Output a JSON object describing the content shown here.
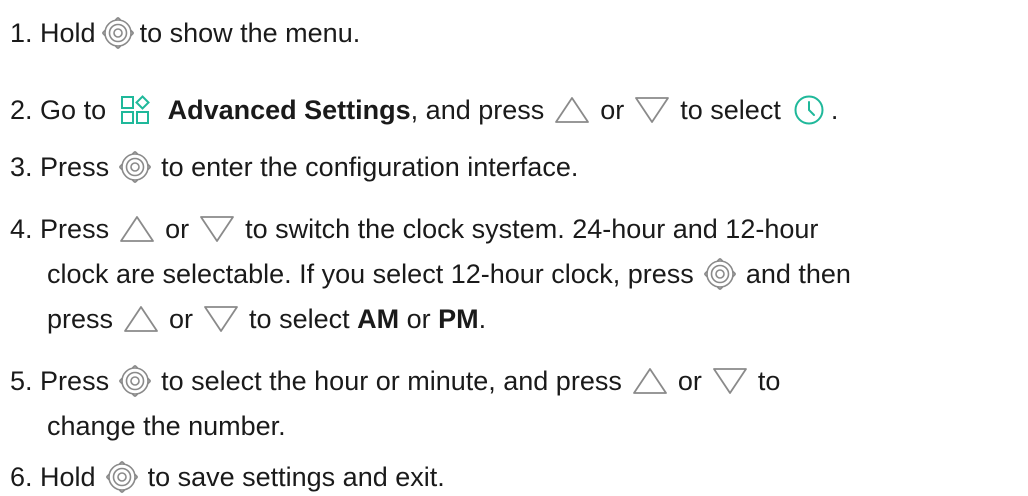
{
  "steps": [
    {
      "num": "1.",
      "text_a": "Hold",
      "text_b": "to show the menu."
    },
    {
      "num": "2.",
      "text_a": "Go to",
      "bold_a": "Advanced Settings",
      "text_b": ", and press",
      "or": "or",
      "text_c": "to select",
      "end": "."
    },
    {
      "num": "3.",
      "text_a": "Press",
      "text_b": "to enter the configuration interface."
    },
    {
      "num": "4.",
      "line1_a": "Press",
      "or": "or",
      "line1_b": "to switch the clock system. 24-hour and 12-hour",
      "line2_a": "clock are selectable. If you select 12-hour clock, press",
      "line2_b": "and then",
      "line3_a": "press",
      "line3_b": "to select",
      "am": "AM",
      "line3_c": "or",
      "pm": "PM",
      "end": "."
    },
    {
      "num": "5.",
      "line1_a": "Press",
      "line1_b": "to select the hour or minute, and press",
      "or": "or",
      "line1_c": "to",
      "line2": "change the number."
    },
    {
      "num": "6.",
      "text_a": "Hold",
      "text_b": "to save settings and exit."
    }
  ],
  "icons": {
    "ok": "ok-button-icon",
    "up": "up-triangle-icon",
    "down": "down-triangle-icon",
    "settings": "advanced-settings-icon",
    "clock": "clock-icon"
  },
  "colors": {
    "text": "#1a1a1a",
    "accent": "#1fb89a",
    "icon_gray": "#8a8a8a"
  }
}
